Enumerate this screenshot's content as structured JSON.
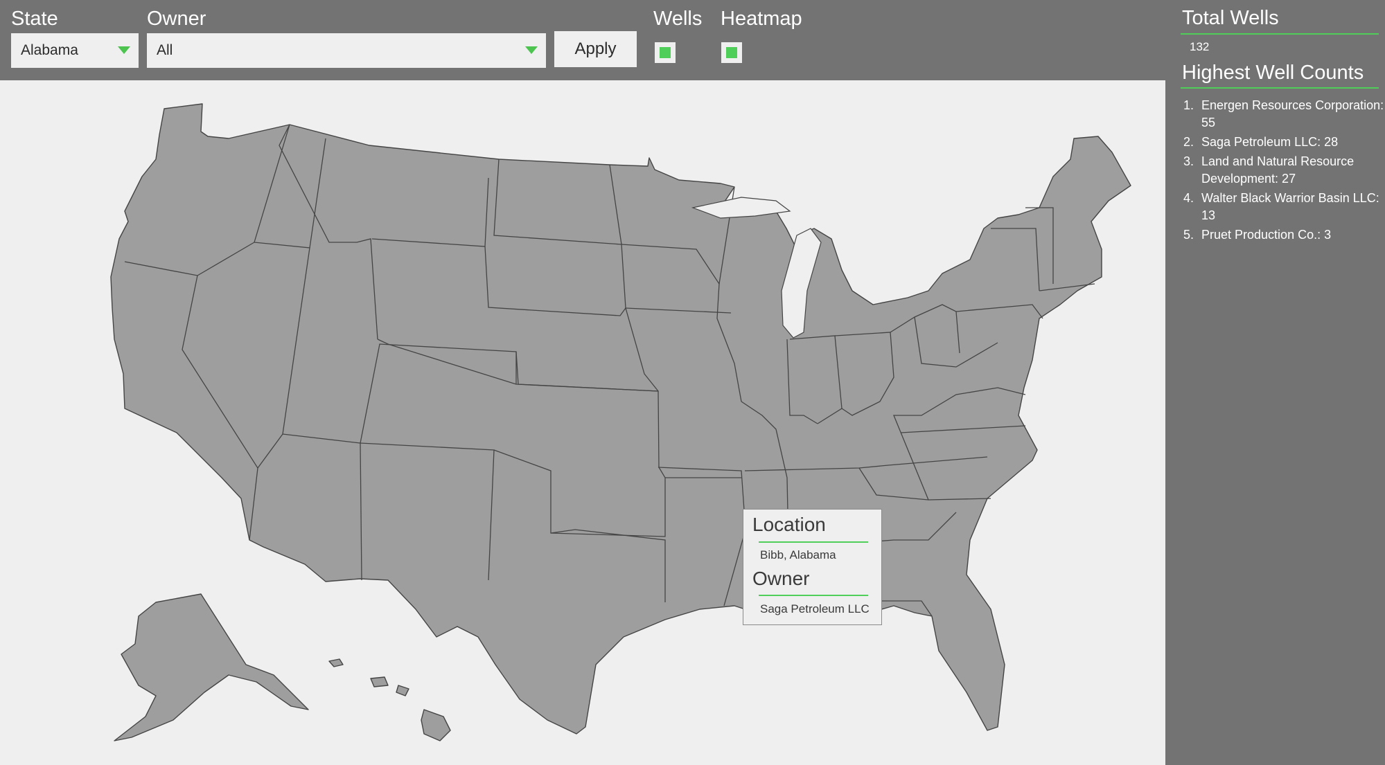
{
  "controls": {
    "state_label": "State",
    "state_value": "Alabama",
    "owner_label": "Owner",
    "owner_value": "All",
    "apply_label": "Apply",
    "wells_label": "Wells",
    "wells_checked": true,
    "heatmap_label": "Heatmap",
    "heatmap_checked": true
  },
  "colors": {
    "accent": "#4fcf5a",
    "panel": "#737373",
    "map_bg": "#efefef",
    "state_fill": "#9e9e9e",
    "heat_high": "#ff1a1a"
  },
  "tooltip": {
    "location_heading": "Location",
    "location_value": "Bibb, Alabama",
    "owner_heading": "Owner",
    "owner_value": "Saga Petroleum LLC"
  },
  "sidebar": {
    "total_heading": "Total Wells",
    "total_value": "132",
    "counts_heading": "Highest Well Counts",
    "counts": [
      {
        "label": "Energen Resources Corporation: 55"
      },
      {
        "label": "Saga Petroleum LLC: 28"
      },
      {
        "label": "Land and Natural Resource Development: 27"
      },
      {
        "label": "Walter Black Warrior Basin LLC: 13"
      },
      {
        "label": "Pruet Production Co.: 3"
      }
    ]
  }
}
